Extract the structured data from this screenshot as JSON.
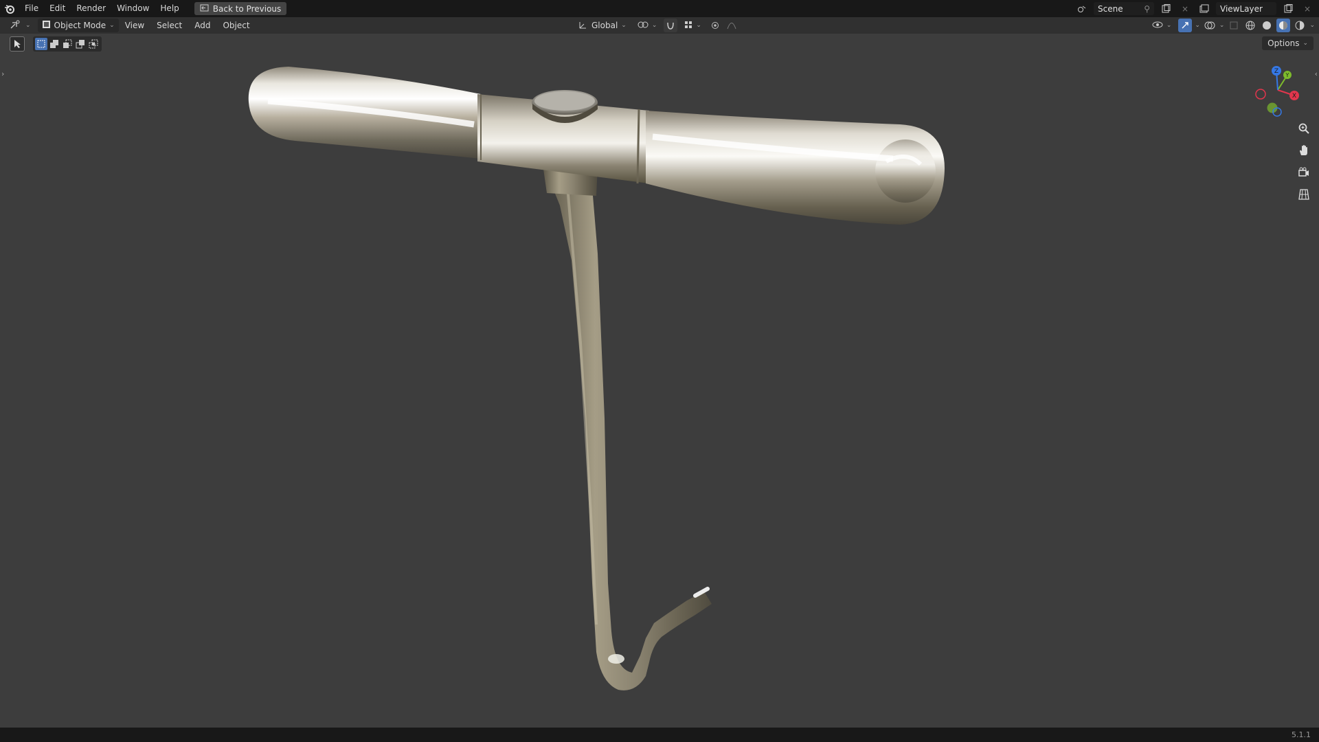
{
  "topbar": {
    "menus": [
      "File",
      "Edit",
      "Render",
      "Window",
      "Help"
    ],
    "back_button": "Back to Previous",
    "scene_name": "Scene",
    "view_layer": "ViewLayer"
  },
  "header": {
    "mode": "Object Mode",
    "menus": [
      "View",
      "Select",
      "Add",
      "Object"
    ],
    "transform_orientation": "Global"
  },
  "viewport": {
    "options_label": "Options",
    "gizmo_axes": {
      "x": "X",
      "y": "Y",
      "z": "Z"
    },
    "object": "metal T-handle hook tool"
  },
  "statusbar": {
    "version": "5.1.1"
  },
  "colors": {
    "x_axis": "#e2364d",
    "y_axis": "#7dbb2c",
    "z_axis": "#3578e5",
    "accent": "#4772b3"
  },
  "icons": [
    "blender-logo",
    "editor-type-icon",
    "object-mode-icon",
    "transform-icon",
    "pivot-icon",
    "snap-icon",
    "proportional-icon",
    "visibility-icon",
    "gizmo-icon",
    "overlay-icon",
    "shading-wireframe-icon",
    "shading-solid-icon",
    "shading-material-icon",
    "shading-rendered-icon",
    "zoom-icon",
    "pan-hand-icon",
    "camera-icon",
    "grid-icon"
  ]
}
